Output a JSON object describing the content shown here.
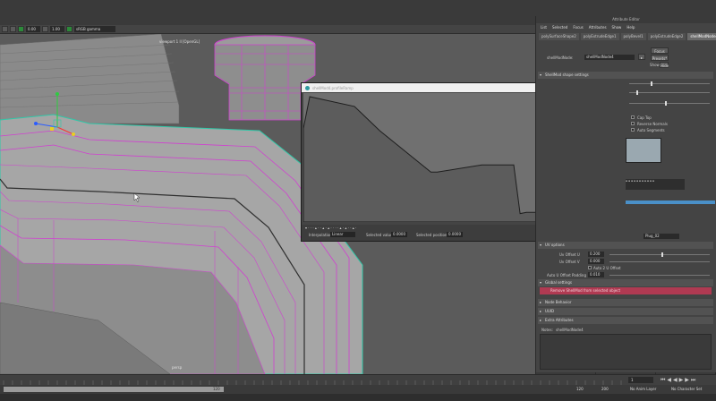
{
  "toolbar": {
    "value_a": "0.00",
    "value_b": "1.00",
    "color_space": "sRGB gamma"
  },
  "viewport": {
    "title": "viewport 1 ll [OpenGL]",
    "camera": "persp"
  },
  "ramp_window": {
    "title": "shellMod4.profileRamp",
    "interpolation_label": "Interpolation",
    "interpolation_value": "Linear",
    "selected_value_label": "Selected value",
    "selected_value": "0.0000",
    "selected_position_label": "Selected position",
    "selected_position": "0.0000",
    "curve": {
      "positions": [
        0.0,
        0.02,
        0.16,
        0.24,
        0.4,
        0.42,
        0.56,
        0.58,
        0.66,
        0.68,
        0.7,
        1.0
      ],
      "values": [
        0.74,
        1.0,
        0.92,
        0.72,
        0.38,
        0.38,
        0.44,
        0.44,
        0.44,
        0.04,
        0.05,
        0.05
      ]
    }
  },
  "attr_editor": {
    "title": "Attribute Editor",
    "menu": [
      "List",
      "Selected",
      "Focus",
      "Attributes",
      "Show",
      "Help"
    ],
    "tabs": [
      "polySurfaceShape2",
      "polyExtrudeEdge1",
      "polyBevel1",
      "polyExtrudeEdge2",
      "shellModNode4"
    ],
    "node_label": "shellModNode:",
    "node_name": "shellModNode4",
    "focus_btn": "Focus",
    "presets_btn": "Presets*",
    "show_btn": "Show",
    "hide_btn": "Hide",
    "shape_section": "ShellMod shape settings",
    "cap_top": "Cap Top",
    "reverse_normals": "Reverse Normals",
    "auto_segments": "Auto Segments",
    "plug_field": "Plug_02",
    "uv_section": "UV options",
    "uv_offset_u_label": "Uv Offset U",
    "uv_offset_u": "0.200",
    "uv_offset_v_label": "Uv Offset V",
    "uv_offset_v": "0.000",
    "auto_uv_offset": "Auto 2 U Offset",
    "auto_uv_padding_label": "Auto U Offset Padding",
    "auto_uv_padding": "0.010",
    "global_section": "Global settings",
    "remove_btn": "Remove ShellMod from selected object",
    "node_behavior": "Node Behavior",
    "uuid": "UUID",
    "extra_attrs": "Extra Attributes",
    "notes_label": "Notes:",
    "notes_value": "shellModNode4",
    "bottom_select": "Select",
    "bottom_load": "Load Attributes",
    "bottom_copy": "Copy Tab"
  },
  "timeline": {
    "current_frame": "1",
    "range_start": "120",
    "range_end": "120",
    "range_end_b": "200",
    "anim_layer": "No Anim Layer",
    "char_set": "No Character Set"
  },
  "colors": {
    "selection_magenta": "#d040d0",
    "active_cyan": "#30c8a8",
    "remove_red": "#b03a52"
  }
}
